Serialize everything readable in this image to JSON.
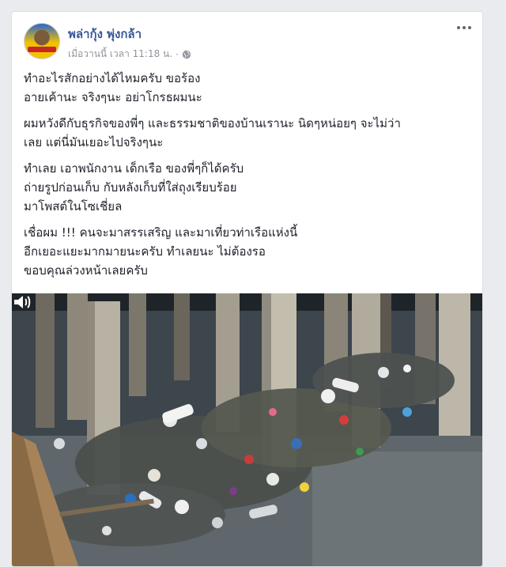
{
  "post": {
    "author": "พล่ากุ้ง พุ่งกล้า",
    "timestamp": "เมื่อวานนี้ เวลา 11:18 น.",
    "privacy_icon": "globe-icon",
    "paragraphs": [
      [
        "ทำอะไรสักอย่างได้ไหมครับ ขอร้อง",
        "อายเค้านะ จริงๆนะ อย่าโกรธผมนะ"
      ],
      [
        "ผมหวังดีกับธุรกิจของพี่ๆ และธรรมชาติของบ้านเรานะ นิดๆหน่อยๆ จะไม่ว่า",
        "เลย แต่นี่มันเยอะไปจริงๆนะ"
      ],
      [
        "ทำเลย เอาพนักงาน เด็กเรือ ของพี่ๆก็ได้ครับ",
        "ถ่ายรูปก่อนเก็บ กับหลังเก็บที่ใส่ถุงเรียบร้อย",
        "มาโพสต์ในโซเชี่ยล"
      ],
      [
        "เชื่อผม !!! คนจะมาสรรเสริญ และมาเที่ยวท่าเรือแห่งนี้",
        "อีกเยอะแยะมากมายนะครับ ทำเลยนะ ไม่ต้องรอ",
        "ขอบคุณล่วงหน้าเลยครับ"
      ]
    ],
    "more_icon": "more-options-icon",
    "media_icon": "volume-icon"
  },
  "colors": {
    "author": "#385898",
    "meta": "#90949c",
    "text": "#1d2129",
    "background": "#e9ebee"
  }
}
